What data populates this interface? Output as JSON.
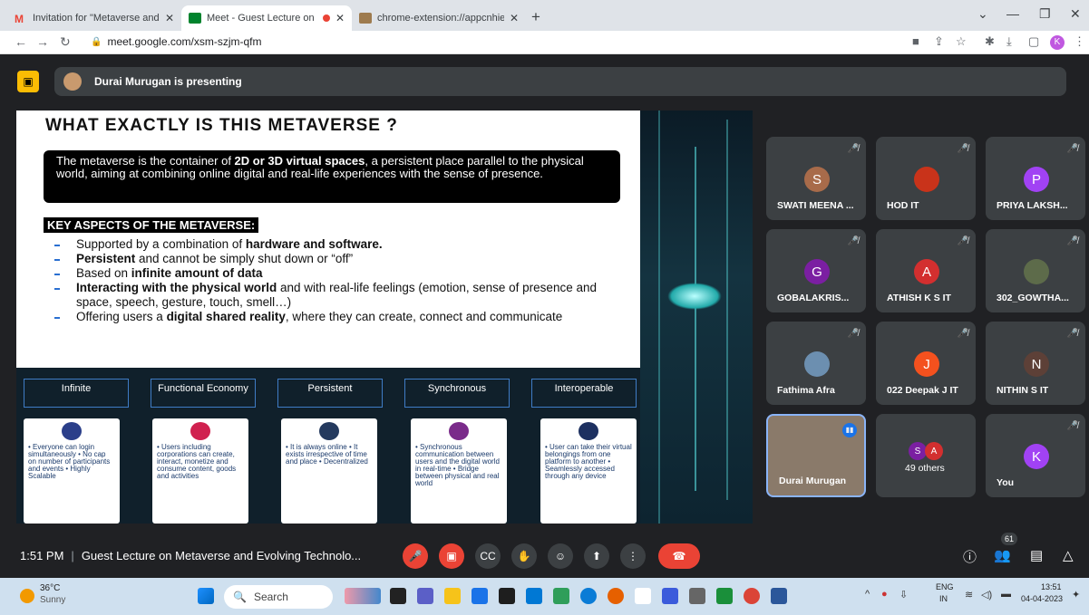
{
  "tabs": [
    {
      "title": "Invitation for \"Metaverse and Evo",
      "fav_color": "#ea4335"
    },
    {
      "title": "Meet - Guest Lecture on Me",
      "fav_color": "#00832d"
    },
    {
      "title": "chrome-extension://appcnhiefcic",
      "fav_color": "#9e7b4e"
    }
  ],
  "address": {
    "url": "meet.google.com/xsm-szjm-qfm"
  },
  "presenting": {
    "text": "Durai Murugan is presenting"
  },
  "slide": {
    "title": "WHAT EXACTLY IS THIS METAVERSE ?",
    "definition_a": "The metaverse is the container of ",
    "definition_b": "2D or 3D virtual spaces",
    "definition_c": ", a persistent place parallel to the physical world, aiming at combining online digital and real-life experiences with the sense of presence.",
    "key_heading": "KEY ASPECTS OF THE METAVERSE:",
    "bullets": [
      {
        "a": "Supported by a combination of ",
        "b": "hardware and software.",
        "c": ""
      },
      {
        "a": "",
        "b": "Persistent",
        "c": " and cannot be simply shut down or “off”"
      },
      {
        "a": "Based on ",
        "b": "infinite amount of data",
        "c": ""
      },
      {
        "a": "",
        "b": "Interacting with the physical world",
        "c": " and with real-life feelings (emotion, sense of presence and space, speech, gesture, touch, smell…)"
      },
      {
        "a": "Offering users a ",
        "b": "digital shared reality",
        "c": ", where they can create, connect and communicate"
      }
    ],
    "aspects": [
      "Infinite",
      "Functional Economy",
      "Persistent",
      "Synchronous",
      "Interoperable"
    ],
    "cards": [
      "• Everyone can login simultaneously • No cap on number of participants and events • Highly Scalable",
      "• Users including corporations can create, interact, monetize and consume content, goods and activities",
      "• It is always online • It exists irrespective of time and place • Decentralized",
      "• Synchronous communication between users and the digital world in real-time • Bridge between physical and real world",
      "• User can take their virtual belongings from one platform to another • Seamlessly accessed through any device"
    ]
  },
  "participants": [
    {
      "name": "SWATI MEENA ...",
      "initial": "S",
      "color": "#a86b4a"
    },
    {
      "name": "HOD IT",
      "initial": "",
      "color": "#c9331a"
    },
    {
      "name": "PRIYA LAKSH...",
      "initial": "P",
      "color": "#a142f4"
    },
    {
      "name": "GOBALAKRIS...",
      "initial": "G",
      "color": "#7b1fa2"
    },
    {
      "name": "ATHISH K S IT",
      "initial": "A",
      "color": "#d32f2f"
    },
    {
      "name": "302_GOWTHA...",
      "initial": "",
      "color": "#5d6b4a"
    },
    {
      "name": "Fathima Afra",
      "initial": "",
      "color": "#6c8fb0"
    },
    {
      "name": "022 Deepak J IT",
      "initial": "J",
      "color": "#f4511e"
    },
    {
      "name": "NITHIN S IT",
      "initial": "N",
      "color": "#5d4037"
    },
    {
      "name": "Durai Murugan",
      "initial": "",
      "color": "#8a7a6a"
    },
    {
      "name": "49 others",
      "initial": "",
      "color": "#3c4043"
    },
    {
      "name": "You",
      "initial": "K",
      "color": "#a142f4"
    }
  ],
  "others_avatars": [
    "S",
    "A"
  ],
  "meeting": {
    "time": "1:51 PM",
    "title": "Guest Lecture on Metaverse and Evolving Technolo...",
    "people_count": "61"
  },
  "taskbar": {
    "weather_temp": "36°C",
    "weather_desc": "Sunny",
    "search_label": "Search",
    "lang_top": "ENG",
    "lang_bottom": "IN",
    "clock_time": "13:51",
    "clock_date": "04-04-2023"
  }
}
